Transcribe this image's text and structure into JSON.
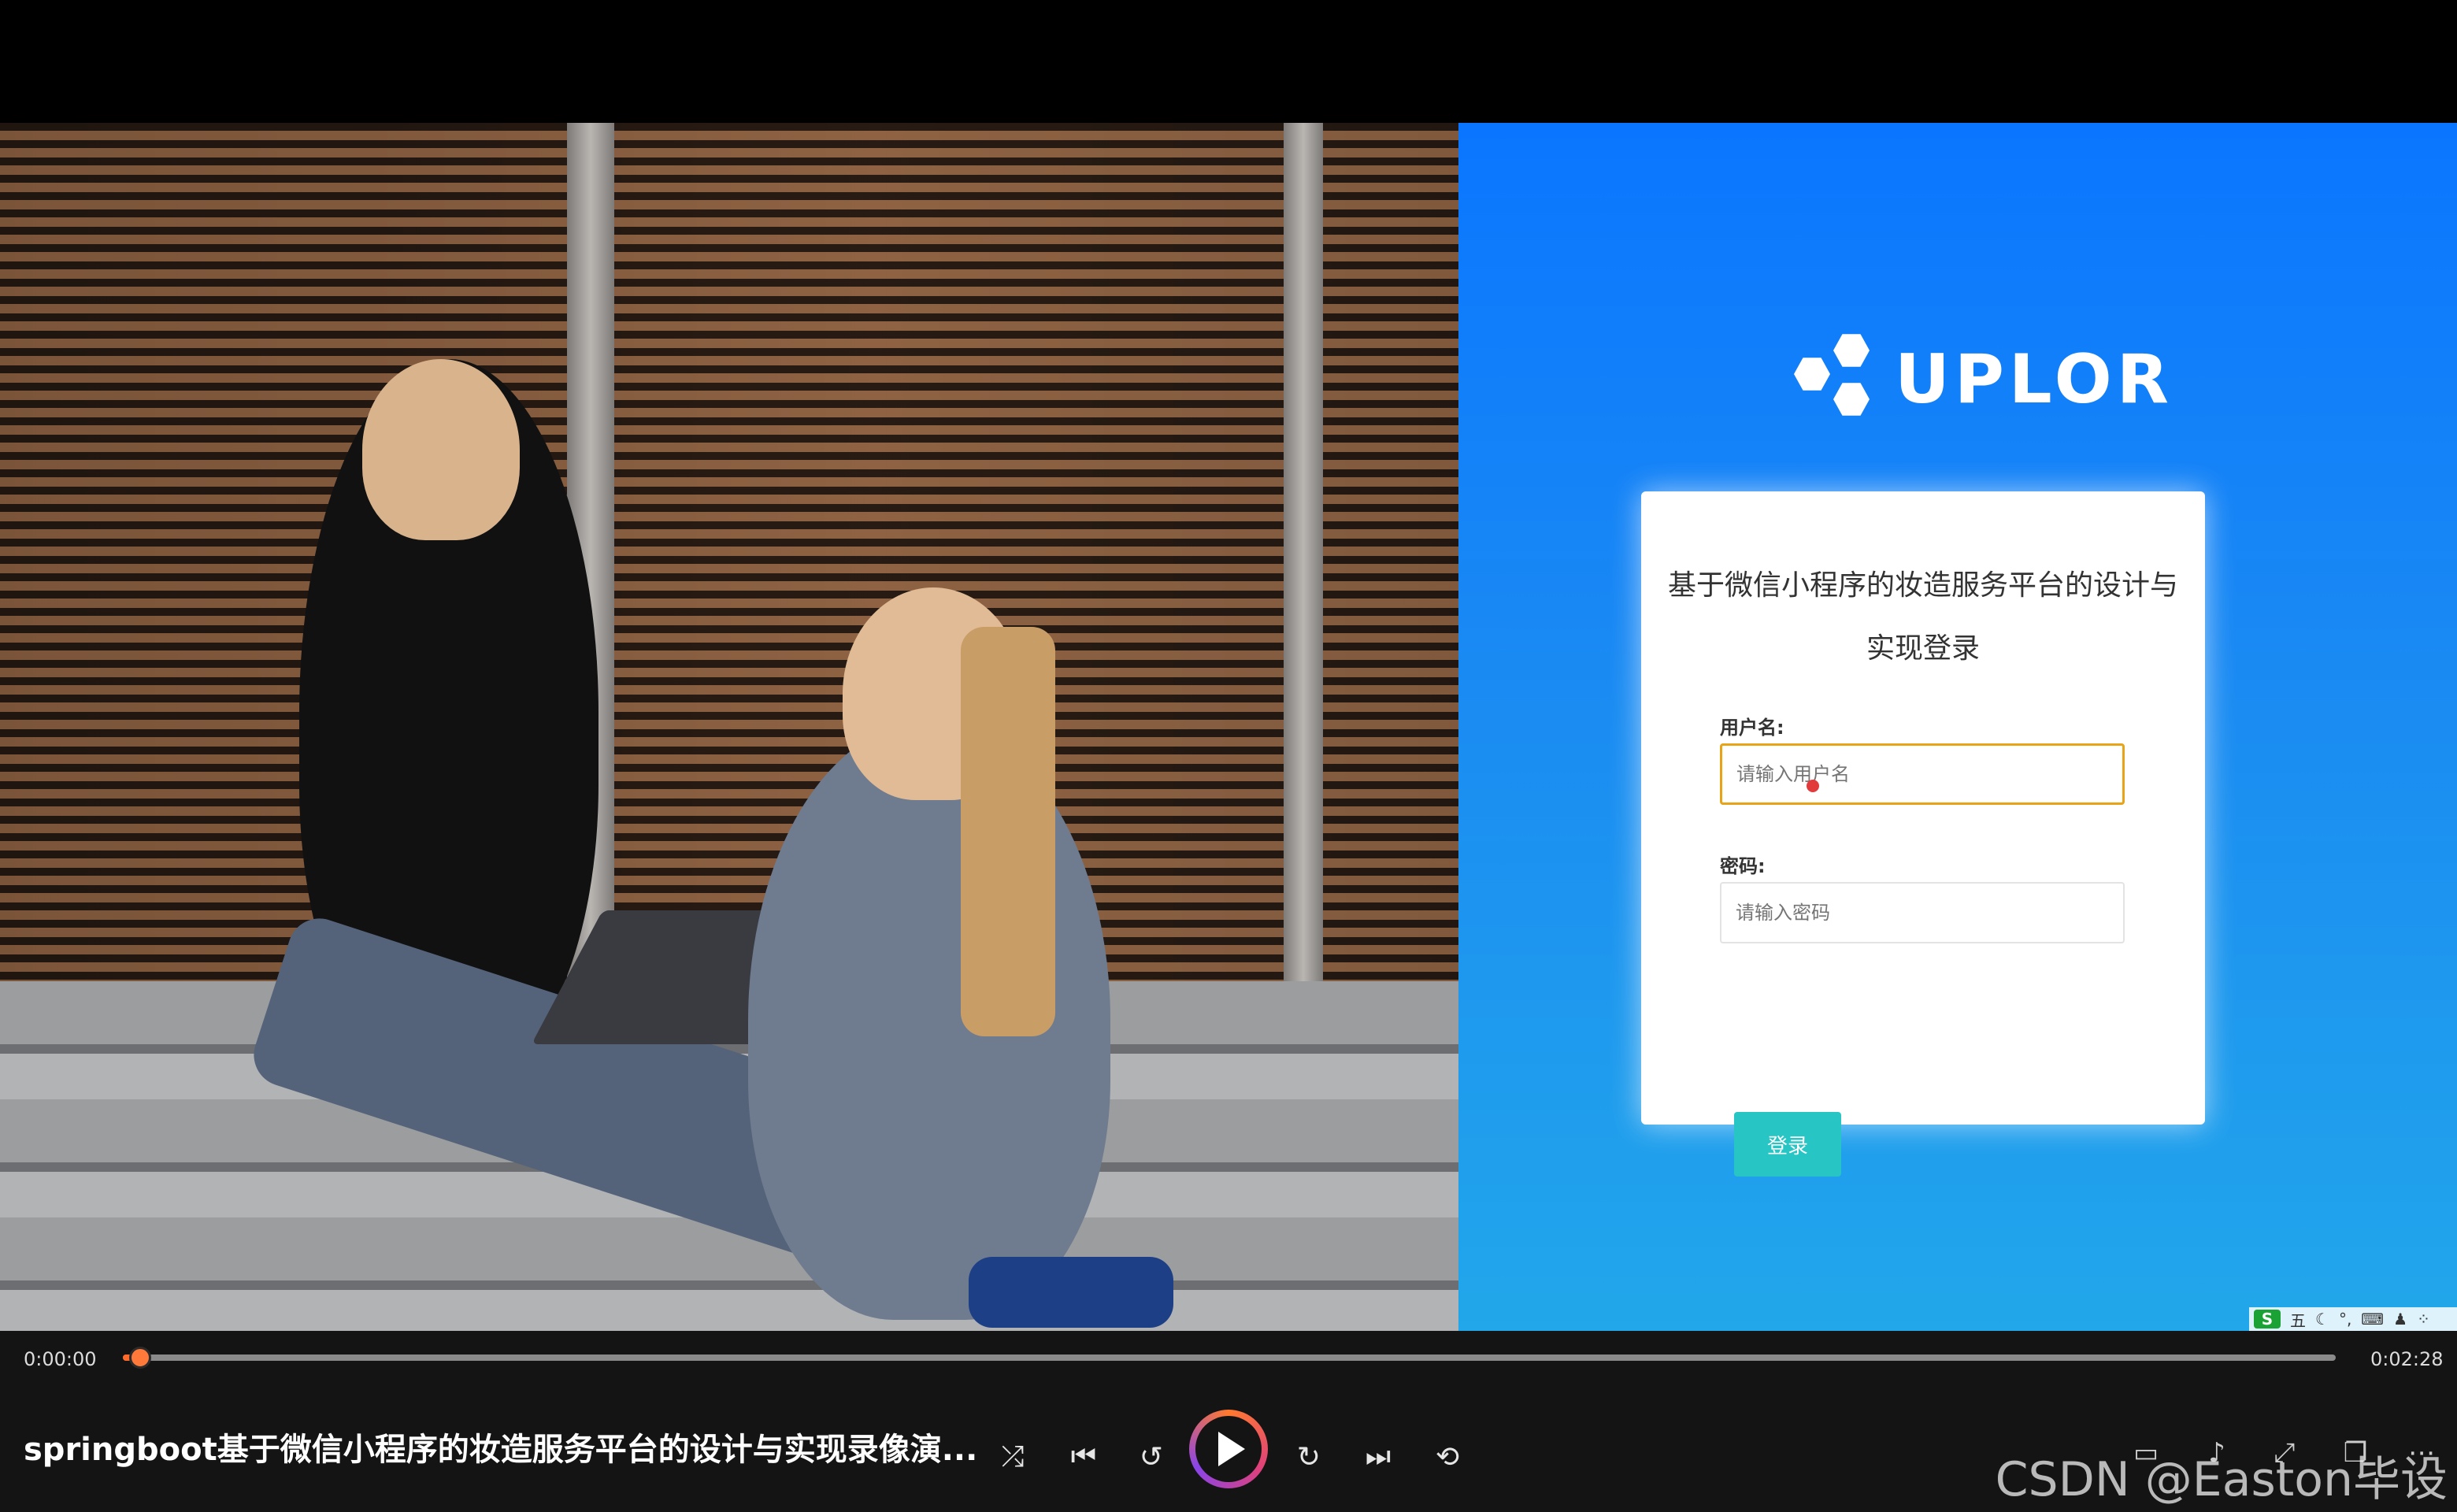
{
  "login": {
    "logo_text": "UPLOR",
    "title": "基于微信小程序的妆造服务平台的设计与实现登录",
    "username_label": "用户名:",
    "username_placeholder": "请输入用户名",
    "password_label": "密码:",
    "password_placeholder": "请输入密码",
    "login_button": "登录"
  },
  "ime": {
    "logo": "S",
    "mode": "五"
  },
  "player": {
    "time_current": "0:00:00",
    "time_total": "0:02:28",
    "progress_fraction": 0.0,
    "video_title": "springboot基于微信小程序的妆造服务平台的设计与实现录像演...",
    "watermark": "CSDN @Easton毕设",
    "controls": [
      "shuffle-icon",
      "previous-icon",
      "rewind-10-icon",
      "play-icon",
      "forward-30-icon",
      "next-icon",
      "loop-icon"
    ],
    "right_controls": [
      "subtitles-icon",
      "volume-icon",
      "fullscreen-icon",
      "popout-icon",
      "more-icon"
    ],
    "colors": {
      "accent": "#ff6a2b",
      "background": "#141414"
    }
  }
}
